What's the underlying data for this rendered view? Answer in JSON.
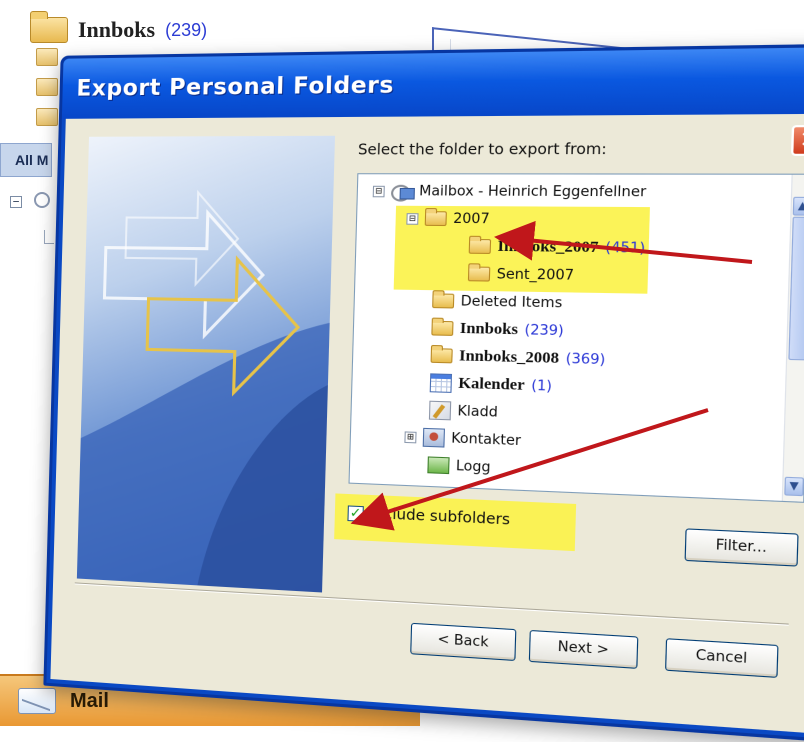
{
  "background": {
    "folder_title": "Innboks",
    "folder_count": "(239)",
    "nav_tab": "All M",
    "mail_bar_label": "Mail"
  },
  "dialog": {
    "title": "Export Personal Folders",
    "close_glyph": "✕",
    "select_label": "Select the folder to export from:",
    "tree": [
      {
        "label": "Mailbox - Heinrich Eggenfellner",
        "count": "",
        "expander": "⊟",
        "icon": "mailbox-icon",
        "bold": false
      },
      {
        "label": "2007",
        "count": "",
        "expander": "⊟",
        "icon": "folder-icon",
        "bold": false
      },
      {
        "label": "Innboks_2007",
        "count": "(451)",
        "expander": "",
        "icon": "folder-icon",
        "bold": true
      },
      {
        "label": "Sent_2007",
        "count": "",
        "expander": "",
        "icon": "folder-icon",
        "bold": false
      },
      {
        "label": "Deleted Items",
        "count": "",
        "expander": "",
        "icon": "folder-icon",
        "bold": false
      },
      {
        "label": "Innboks",
        "count": "(239)",
        "expander": "",
        "icon": "folder-icon",
        "bold": true
      },
      {
        "label": "Innboks_2008",
        "count": "(369)",
        "expander": "",
        "icon": "folder-icon",
        "bold": true
      },
      {
        "label": "Kalender",
        "count": "(1)",
        "expander": "",
        "icon": "calendar-icon",
        "bold": true
      },
      {
        "label": "Kladd",
        "count": "",
        "expander": "",
        "icon": "draft-icon",
        "bold": false
      },
      {
        "label": "Kontakter",
        "count": "",
        "expander": "⊞",
        "icon": "contacts-icon",
        "bold": false
      },
      {
        "label": "Logg",
        "count": "",
        "expander": "",
        "icon": "journal-icon",
        "bold": false
      }
    ],
    "include_subfolders": {
      "label": "Include subfolders",
      "checked": true
    },
    "buttons": {
      "filter": "Filter...",
      "back": "< Back",
      "next": "Next >",
      "cancel": "Cancel"
    }
  },
  "colors": {
    "title_bar": "#0a58e0",
    "dialog_face": "#ece9d8",
    "highlight": "#fbf24a",
    "annotation_arrow": "#c0171b",
    "count_text": "#2a37d6",
    "mail_bar": "#e99833"
  }
}
